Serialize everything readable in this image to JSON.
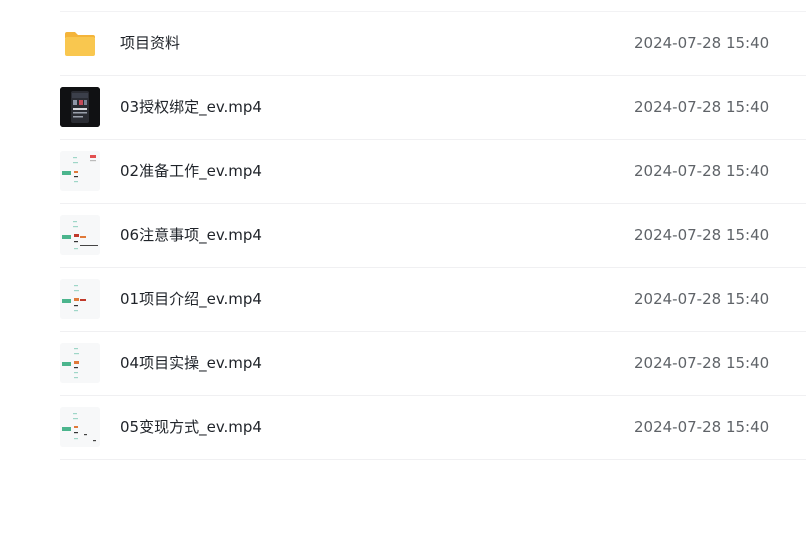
{
  "files": [
    {
      "name": "项目资料",
      "date": "2024-07-28 15:40",
      "kind": "folder",
      "icon": "folder-icon"
    },
    {
      "name": "03授权绑定_ev.mp4",
      "date": "2024-07-28 15:40",
      "kind": "video-dark",
      "icon": "video-thumbnail"
    },
    {
      "name": "02准备工作_ev.mp4",
      "date": "2024-07-28 15:40",
      "kind": "video-light",
      "icon": "video-thumbnail"
    },
    {
      "name": "06注意事项_ev.mp4",
      "date": "2024-07-28 15:40",
      "kind": "video-light",
      "icon": "video-thumbnail"
    },
    {
      "name": "01项目介绍_ev.mp4",
      "date": "2024-07-28 15:40",
      "kind": "video-light",
      "icon": "video-thumbnail"
    },
    {
      "name": "04项目实操_ev.mp4",
      "date": "2024-07-28 15:40",
      "kind": "video-light",
      "icon": "video-thumbnail"
    },
    {
      "name": "05变现方式_ev.mp4",
      "date": "2024-07-28 15:40",
      "kind": "video-light",
      "icon": "video-thumbnail"
    }
  ],
  "colors": {
    "folder": "#f9c74f",
    "folder_dark": "#f4b43a",
    "text": "#1f2329",
    "date": "#5f6368"
  }
}
